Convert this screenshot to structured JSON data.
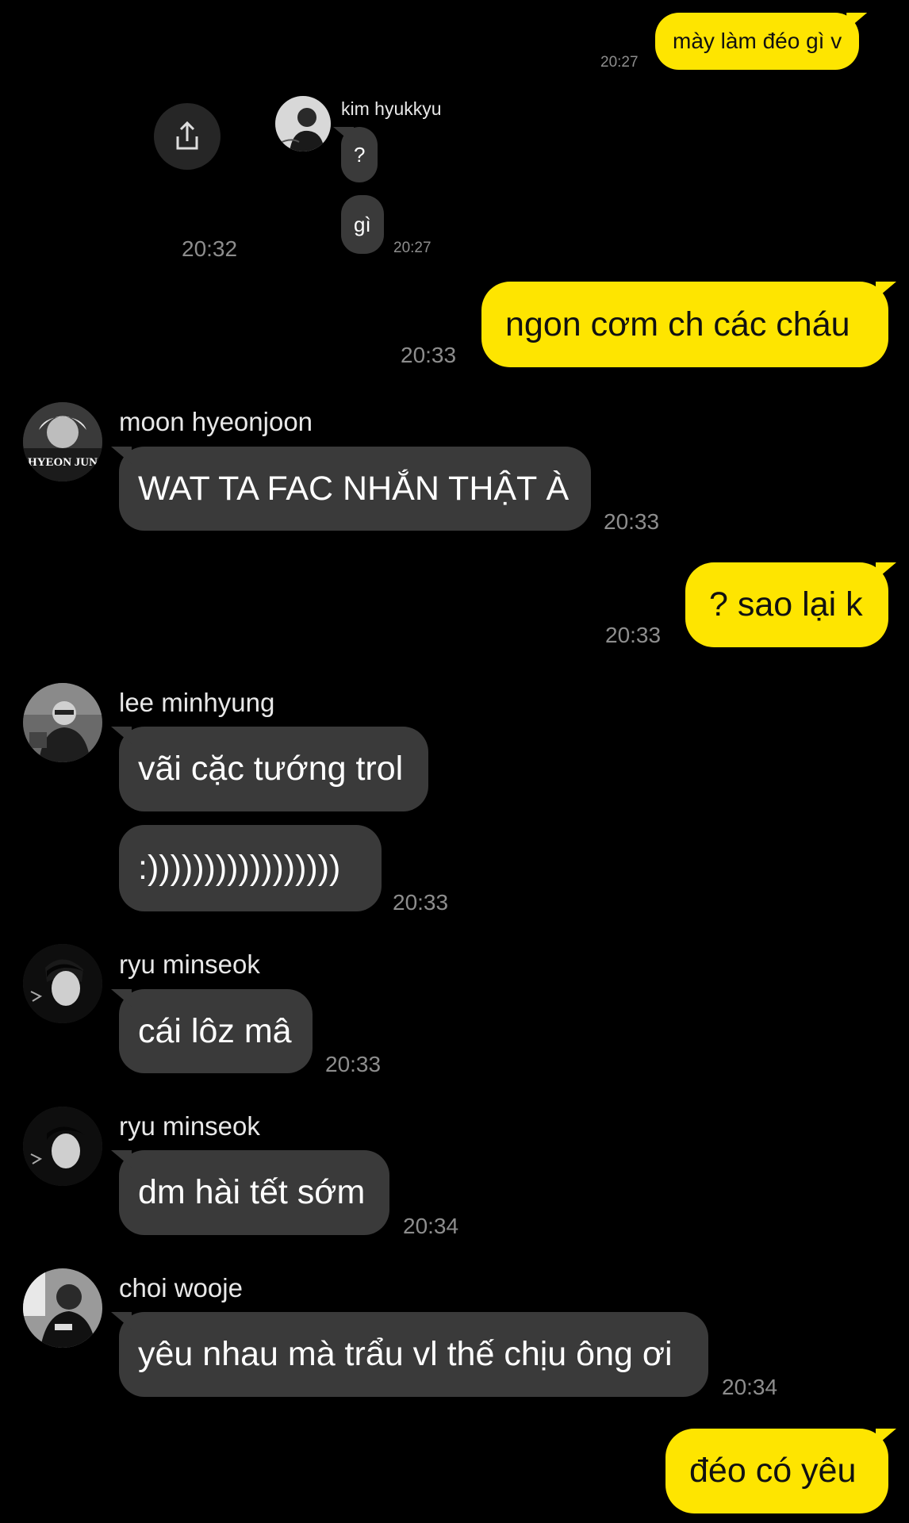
{
  "messages": {
    "m1": {
      "text": "mày làm đéo gì v",
      "time": "20:27"
    },
    "kim": {
      "name": "kim hyukkyu",
      "b1": "?",
      "b2": "gì",
      "time": "20:27",
      "forward_time": "20:32"
    },
    "m2": {
      "text": "ngon cơm ch các cháu",
      "time": "20:33"
    },
    "moon": {
      "name": "moon hyeonjoon",
      "text": "WAT TA FAC NHẮN THẬT À",
      "time": "20:33",
      "avatar_caption": "HYEON JUN"
    },
    "m3": {
      "text": "? sao lại k",
      "time": "20:33"
    },
    "lee": {
      "name": "lee minhyung",
      "b1": "vãi cặc tướng trol",
      "b2": ":)))))))))))))))))",
      "time": "20:33"
    },
    "ryu1": {
      "name": "ryu minseok",
      "text": "cái lôz mâ",
      "time": "20:33"
    },
    "ryu2": {
      "name": "ryu minseok",
      "text": "dm hài tết sớm",
      "time": "20:34"
    },
    "choi": {
      "name": "choi wooje",
      "text": "yêu nhau mà trẩu vl thế chịu ông ơi",
      "time": "20:34"
    },
    "m4": {
      "text": "đéo có yêu"
    }
  },
  "colors": {
    "outgoing": "#fee500",
    "incoming": "#3a3a3a",
    "background": "#000000",
    "timestamp": "#8d8d8d"
  },
  "icons": {
    "share": "share-icon"
  }
}
